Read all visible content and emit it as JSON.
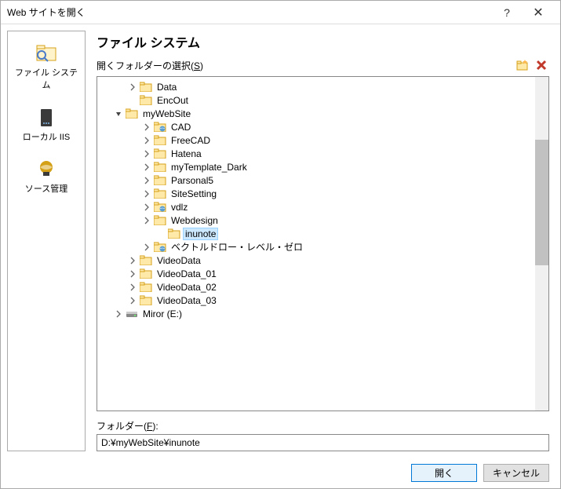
{
  "window": {
    "title": "Web サイトを開く"
  },
  "sidebar": {
    "items": [
      {
        "label": "ファイル システム"
      },
      {
        "label": "ローカル IIS"
      },
      {
        "label": "ソース管理"
      }
    ]
  },
  "main": {
    "title": "ファイル システム",
    "folderSelectLabel": "開くフォルダーの選択(",
    "folderSelectKey": "S",
    "folderSelectClose": ")"
  },
  "tree": {
    "items": [
      {
        "indent": 2,
        "expander": "closed",
        "icon": "folder",
        "label": "Data"
      },
      {
        "indent": 2,
        "expander": "none",
        "icon": "folder",
        "label": "EncOut"
      },
      {
        "indent": 1,
        "expander": "open",
        "icon": "folder",
        "label": "myWebSite"
      },
      {
        "indent": 3,
        "expander": "closed",
        "icon": "webfolder",
        "label": "CAD"
      },
      {
        "indent": 3,
        "expander": "closed",
        "icon": "folder",
        "label": "FreeCAD"
      },
      {
        "indent": 3,
        "expander": "closed",
        "icon": "folder",
        "label": "Hatena"
      },
      {
        "indent": 3,
        "expander": "closed",
        "icon": "folder",
        "label": "myTemplate_Dark"
      },
      {
        "indent": 3,
        "expander": "closed",
        "icon": "folder",
        "label": "Parsonal5"
      },
      {
        "indent": 3,
        "expander": "closed",
        "icon": "folder",
        "label": "SiteSetting"
      },
      {
        "indent": 3,
        "expander": "closed",
        "icon": "webfolder",
        "label": "vdlz"
      },
      {
        "indent": 3,
        "expander": "closed",
        "icon": "folder",
        "label": "Webdesign"
      },
      {
        "indent": 4,
        "expander": "none",
        "icon": "folder",
        "label": "inunote",
        "selected": true
      },
      {
        "indent": 3,
        "expander": "closed",
        "icon": "webfolder",
        "label": "ベクトルドロー・レベル・ゼロ"
      },
      {
        "indent": 2,
        "expander": "closed",
        "icon": "folder",
        "label": "VideoData"
      },
      {
        "indent": 2,
        "expander": "closed",
        "icon": "folder",
        "label": "VideoData_01"
      },
      {
        "indent": 2,
        "expander": "closed",
        "icon": "folder",
        "label": "VideoData_02"
      },
      {
        "indent": 2,
        "expander": "closed",
        "icon": "folder",
        "label": "VideoData_03"
      },
      {
        "indent": 1,
        "expander": "closed",
        "icon": "drive",
        "label": "Miror (E:)"
      }
    ]
  },
  "folderPath": {
    "label": "フォルダー(",
    "key": "F",
    "close": "):",
    "value": "D:¥myWebSite¥inunote"
  },
  "buttons": {
    "open": "開く",
    "cancel": "キャンセル"
  }
}
